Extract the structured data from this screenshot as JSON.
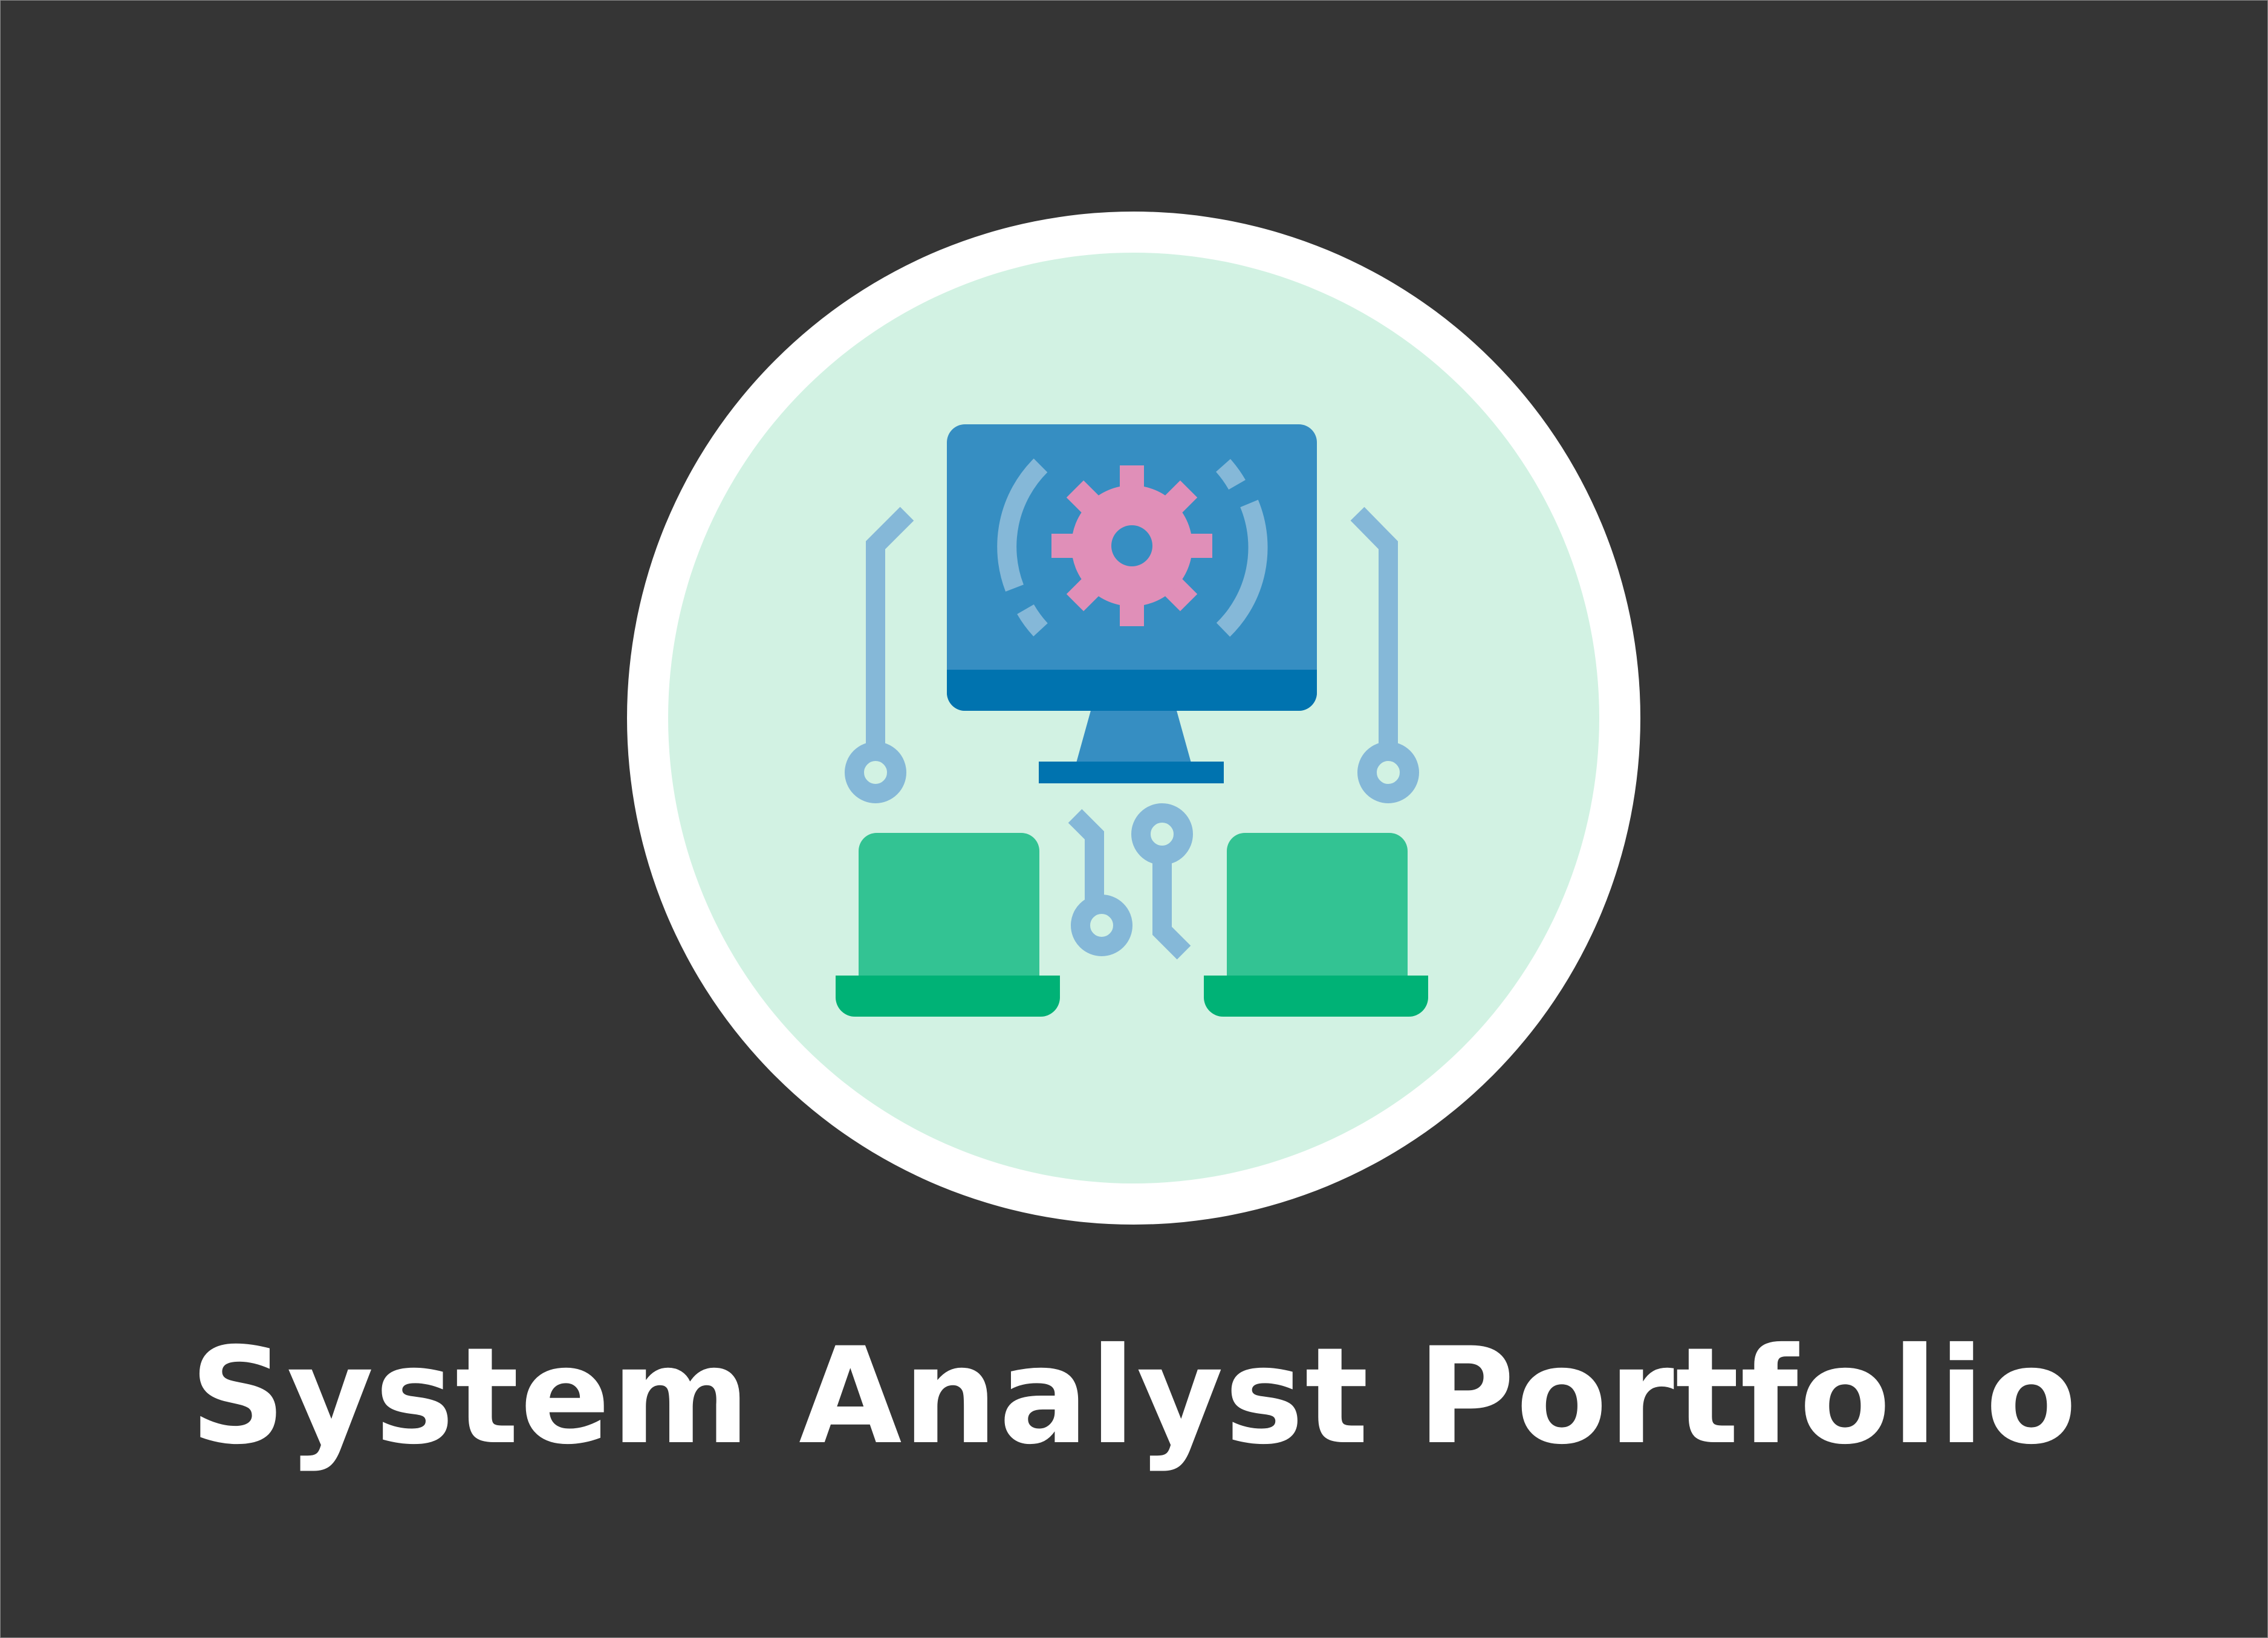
{
  "title": "System Analyst Portfolio",
  "icons": {
    "main": "network-computer-gear-icon",
    "monitor": "monitor-icon",
    "gear": "gear-icon",
    "laptop_left": "laptop-icon",
    "laptop_right": "laptop-icon",
    "circuit": "circuit-connector-icon"
  },
  "colors": {
    "background": "#353535",
    "ring": "#ffffff",
    "badge_fill": "#d2f2e3",
    "monitor_screen": "#368ec2",
    "monitor_base": "#0073af",
    "gear": "#e08fb8",
    "wire": "#85b8d8",
    "laptop_screen": "#33c393",
    "laptop_base": "#00b276",
    "title_text": "#ffffff"
  }
}
